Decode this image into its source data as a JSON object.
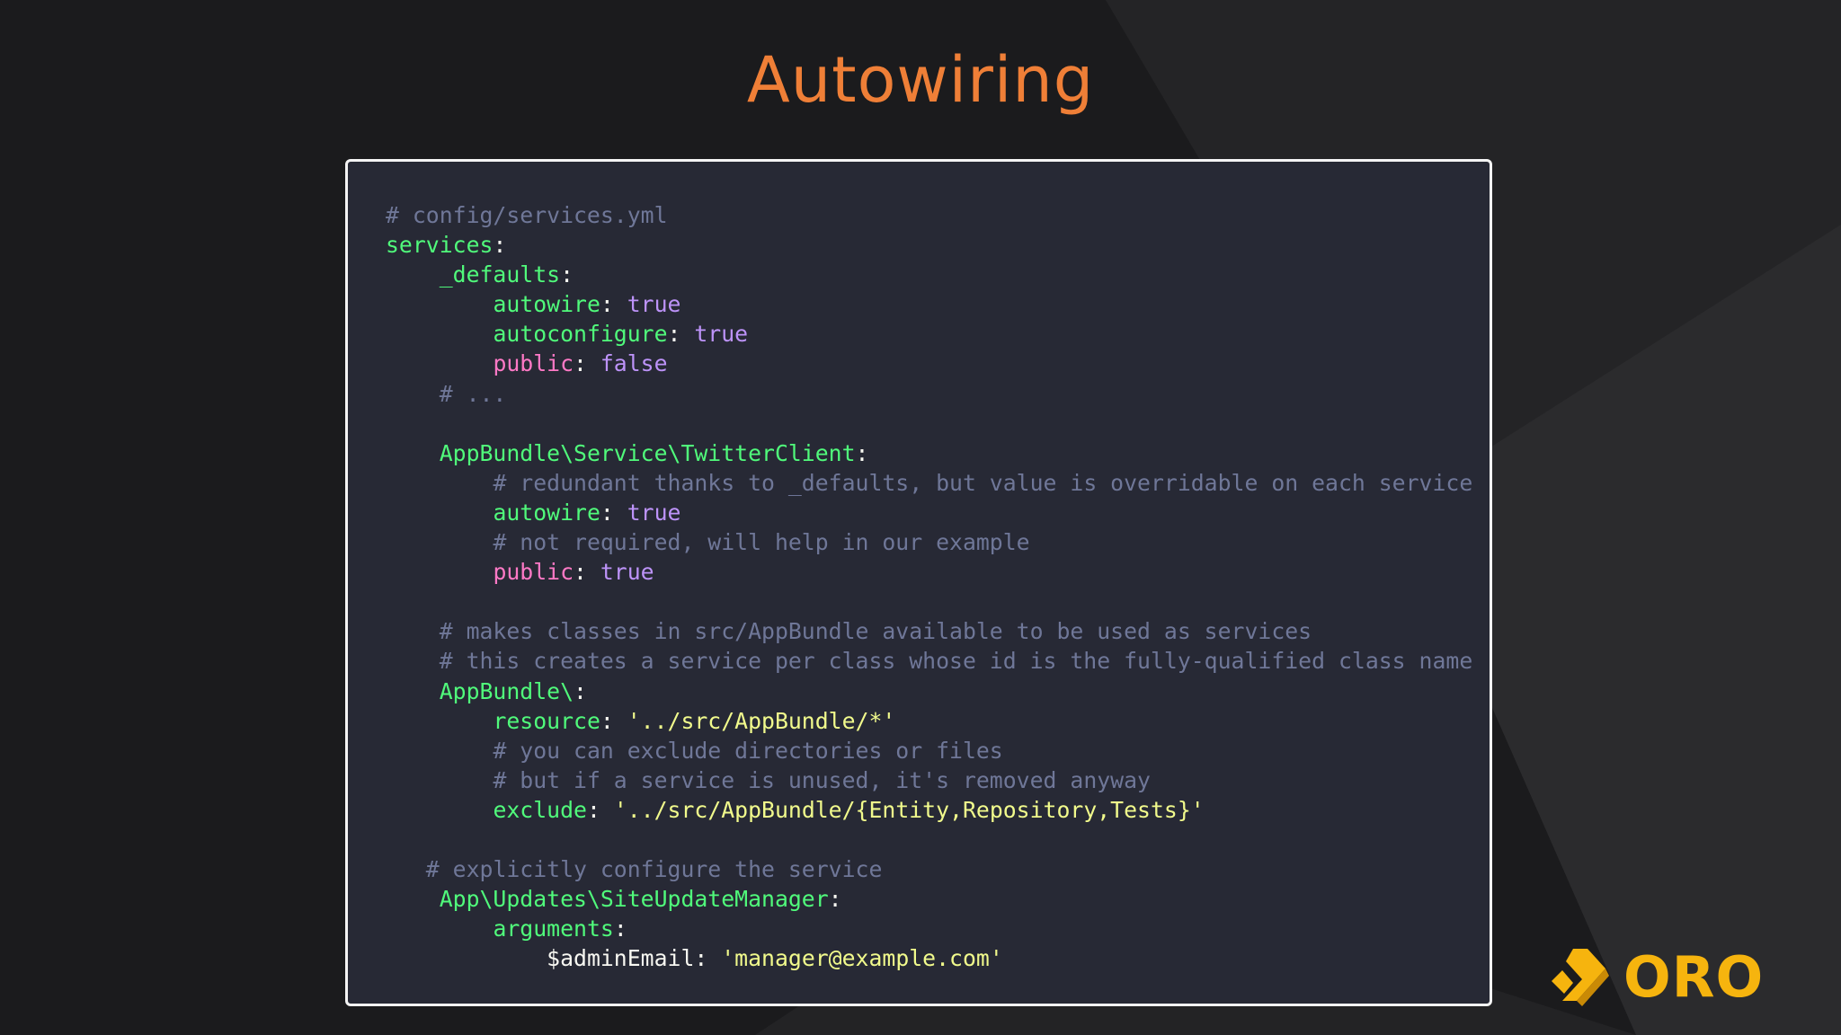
{
  "slide": {
    "title": "Autowiring",
    "logo_text": "ORO"
  },
  "colors": {
    "background": "#1b1b1d",
    "title": "#ef7f37",
    "panel_background": "#272935",
    "panel_border": "#f4f4f4",
    "comment": "#6f7798",
    "key": "#50fa7b",
    "key_public": "#ff79c6",
    "boolean": "#bd93f9",
    "string": "#f1fa8c",
    "plain": "#f8f8f2",
    "logo": "#f6b40e"
  },
  "code": {
    "lines": [
      {
        "indent": "",
        "tokens": [
          {
            "type": "comment",
            "text": "# config/services.yml"
          }
        ]
      },
      {
        "indent": "",
        "tokens": [
          {
            "type": "key",
            "text": "services"
          },
          {
            "type": "punct",
            "text": ":"
          }
        ]
      },
      {
        "indent": "    ",
        "tokens": [
          {
            "type": "key",
            "text": "_defaults"
          },
          {
            "type": "punct",
            "text": ":"
          }
        ]
      },
      {
        "indent": "        ",
        "tokens": [
          {
            "type": "key",
            "text": "autowire"
          },
          {
            "type": "punct",
            "text": ": "
          },
          {
            "type": "bool",
            "text": "true"
          }
        ]
      },
      {
        "indent": "        ",
        "tokens": [
          {
            "type": "key",
            "text": "autoconfigure"
          },
          {
            "type": "punct",
            "text": ": "
          },
          {
            "type": "bool",
            "text": "true"
          }
        ]
      },
      {
        "indent": "        ",
        "tokens": [
          {
            "type": "pink",
            "text": "public"
          },
          {
            "type": "punct",
            "text": ": "
          },
          {
            "type": "bool",
            "text": "false"
          }
        ]
      },
      {
        "indent": "    ",
        "tokens": [
          {
            "type": "comment",
            "text": "# ..."
          }
        ]
      },
      {
        "indent": "",
        "tokens": []
      },
      {
        "indent": "    ",
        "tokens": [
          {
            "type": "key",
            "text": "AppBundle\\Service\\TwitterClient"
          },
          {
            "type": "punct",
            "text": ":"
          }
        ]
      },
      {
        "indent": "        ",
        "tokens": [
          {
            "type": "comment",
            "text": "# redundant thanks to _defaults, but value is overridable on each service"
          }
        ]
      },
      {
        "indent": "        ",
        "tokens": [
          {
            "type": "key",
            "text": "autowire"
          },
          {
            "type": "punct",
            "text": ": "
          },
          {
            "type": "bool",
            "text": "true"
          }
        ]
      },
      {
        "indent": "        ",
        "tokens": [
          {
            "type": "comment",
            "text": "# not required, will help in our example"
          }
        ]
      },
      {
        "indent": "        ",
        "tokens": [
          {
            "type": "pink",
            "text": "public"
          },
          {
            "type": "punct",
            "text": ": "
          },
          {
            "type": "bool",
            "text": "true"
          }
        ]
      },
      {
        "indent": "",
        "tokens": []
      },
      {
        "indent": "    ",
        "tokens": [
          {
            "type": "comment",
            "text": "# makes classes in src/AppBundle available to be used as services"
          }
        ]
      },
      {
        "indent": "    ",
        "tokens": [
          {
            "type": "comment",
            "text": "# this creates a service per class whose id is the fully-qualified class name"
          }
        ]
      },
      {
        "indent": "    ",
        "tokens": [
          {
            "type": "key",
            "text": "AppBundle\\"
          },
          {
            "type": "punct",
            "text": ":"
          }
        ]
      },
      {
        "indent": "        ",
        "tokens": [
          {
            "type": "key",
            "text": "resource"
          },
          {
            "type": "punct",
            "text": ": "
          },
          {
            "type": "string",
            "text": "'../src/AppBundle/*'"
          }
        ]
      },
      {
        "indent": "        ",
        "tokens": [
          {
            "type": "comment",
            "text": "# you can exclude directories or files"
          }
        ]
      },
      {
        "indent": "        ",
        "tokens": [
          {
            "type": "comment",
            "text": "# but if a service is unused, it's removed anyway"
          }
        ]
      },
      {
        "indent": "        ",
        "tokens": [
          {
            "type": "key",
            "text": "exclude"
          },
          {
            "type": "punct",
            "text": ": "
          },
          {
            "type": "string",
            "text": "'../src/AppBundle/{Entity,Repository,Tests}'"
          }
        ]
      },
      {
        "indent": "",
        "tokens": []
      },
      {
        "indent": "   ",
        "tokens": [
          {
            "type": "comment",
            "text": "# explicitly configure the service"
          }
        ]
      },
      {
        "indent": "    ",
        "tokens": [
          {
            "type": "key",
            "text": "App\\Updates\\SiteUpdateManager"
          },
          {
            "type": "punct",
            "text": ":"
          }
        ]
      },
      {
        "indent": "        ",
        "tokens": [
          {
            "type": "key",
            "text": "arguments"
          },
          {
            "type": "punct",
            "text": ":"
          }
        ]
      },
      {
        "indent": "            ",
        "tokens": [
          {
            "type": "plain",
            "text": "$adminEmail"
          },
          {
            "type": "punct",
            "text": ": "
          },
          {
            "type": "string",
            "text": "'manager@example.com'"
          }
        ]
      }
    ]
  }
}
